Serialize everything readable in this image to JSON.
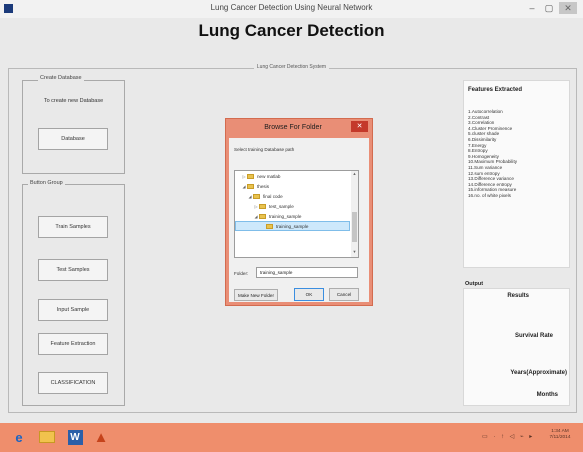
{
  "window": {
    "title": "Lung Cancer Detection Using Neural Network",
    "minimize": "–",
    "maximize": "▢",
    "close": "✕"
  },
  "heading": "Lung Cancer Detection",
  "system_panel": {
    "title": "Lung Cancer Detection System"
  },
  "create_db": {
    "title": "Create Database",
    "description": "To create new Database",
    "button": "Database"
  },
  "button_group": {
    "title": "Button Group",
    "buttons": [
      "Train Samples",
      "Test Samples",
      "Input Sample",
      "Feature Extraction",
      "CLASSIFICATION"
    ]
  },
  "features": {
    "title": "Features Extracted",
    "items": [
      "1.Autocorrelation",
      "2.Contrast",
      "3.Correlation",
      "4.Cluster Prominence",
      "5.cluster shade",
      "6.Dissimilarity",
      "7.Energy",
      "8.Entropy",
      "9.Homogeneity",
      "10.Maximum Probability",
      "11.Sum variance",
      "12.sum entropy",
      "13.Difference variance",
      "14.Difference entropy",
      "15.information measure",
      "16.no. of white pixels"
    ]
  },
  "output": {
    "title": "Output",
    "results": "Results",
    "survival": "Survival Rate",
    "years": "Years(Approximate)",
    "months": "Months"
  },
  "dialog": {
    "title": "Browse For Folder",
    "close": "✕",
    "prompt": "Select training Database path",
    "tree": [
      {
        "label": "new matlab",
        "arrow": "▷"
      },
      {
        "label": "thesis",
        "arrow": "◢"
      },
      {
        "label": "final code",
        "arrow": "◢"
      },
      {
        "label": "test_sample",
        "arrow": "▷"
      },
      {
        "label": "training_sample",
        "arrow": "◢"
      },
      {
        "label": "training_sample",
        "arrow": ""
      }
    ],
    "scroll_up": "▲",
    "scroll_down": "▼",
    "folder_label": "Folder:",
    "folder_value": "training_sample",
    "new_folder_button": "Make New Folder",
    "ok_button": "OK",
    "cancel_button": "Cancel"
  },
  "taskbar": {
    "ie_icon": "e",
    "word_icon": "W",
    "matlab_icon": "▲",
    "tray": "▭ · ↑ ◁ ⌁ ▸",
    "time": "1:34 AM",
    "date": "7/11/2014"
  },
  "colors": {
    "dialog_border": "#e98e76",
    "taskbar": "#ef8e6c",
    "selection": "#cde8fb"
  }
}
